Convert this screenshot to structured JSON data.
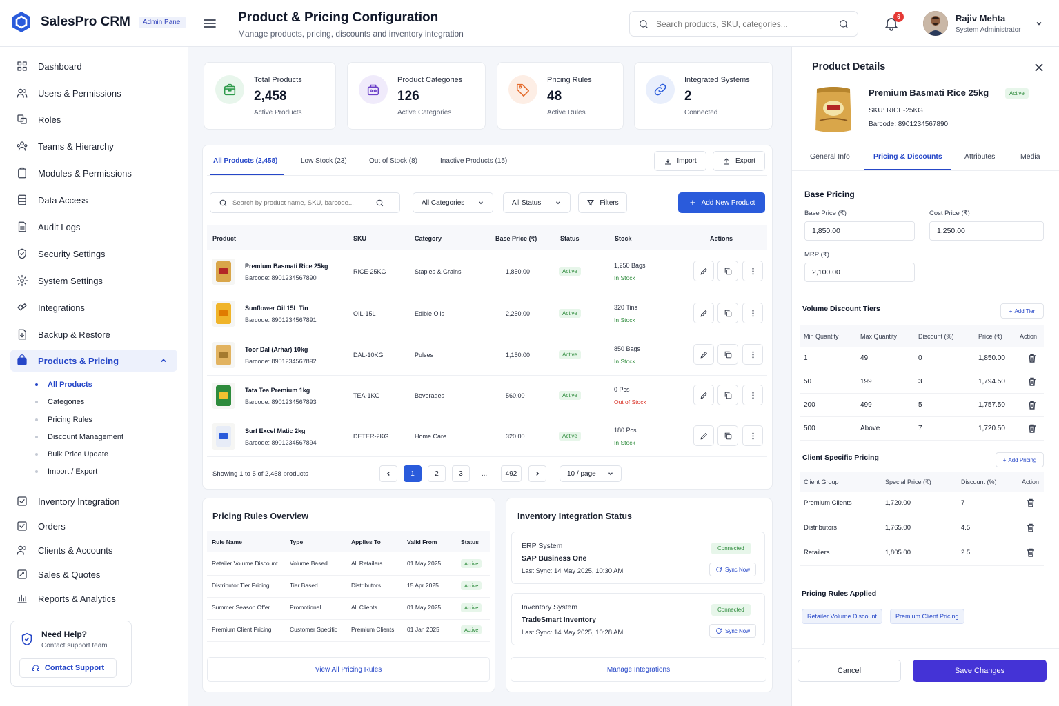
{
  "header": {
    "brand": "SalesPro CRM",
    "brand_tag": "Admin Panel",
    "title": "Product & Pricing Configuration",
    "subtitle": "Manage products, pricing, discounts and inventory integration",
    "search_placeholder": "Search products, SKU, categories...",
    "notifications": "6",
    "user_name": "Rajiv Mehta",
    "user_role": "System Administrator"
  },
  "sidebar": {
    "items": [
      {
        "label": "Dashboard"
      },
      {
        "label": "Users & Permissions"
      },
      {
        "label": "Roles"
      },
      {
        "label": "Teams & Hierarchy"
      },
      {
        "label": "Modules & Permissions"
      },
      {
        "label": "Data Access"
      },
      {
        "label": "Audit Logs"
      },
      {
        "label": "Security Settings"
      },
      {
        "label": "System Settings"
      },
      {
        "label": "Integrations"
      },
      {
        "label": "Backup & Restore"
      },
      {
        "label": "Products & Pricing"
      },
      {
        "label": "Inventory Integration"
      },
      {
        "label": "Orders"
      },
      {
        "label": "Clients & Accounts"
      },
      {
        "label": "Sales & Quotes"
      },
      {
        "label": "Reports & Analytics"
      }
    ],
    "subitems": [
      "All Products",
      "Categories",
      "Pricing Rules",
      "Discount Management",
      "Bulk Price Update",
      "Import / Export"
    ],
    "help_title": "Need Help?",
    "help_sub": "Contact support team",
    "help_button": "Contact Support"
  },
  "stats": [
    {
      "label": "Total Products",
      "value": "2,458",
      "sub": "Active Products",
      "color": "#2e9b4b",
      "bg": "#e8f6ec"
    },
    {
      "label": "Product Categories",
      "value": "126",
      "sub": "Active Categories",
      "color": "#6b3fc8",
      "bg": "#f0ebfb"
    },
    {
      "label": "Pricing Rules",
      "value": "48",
      "sub": "Active Rules",
      "color": "#e46b2c",
      "bg": "#fdeee5"
    },
    {
      "label": "Integrated Systems",
      "value": "2",
      "sub": "Connected",
      "color": "#2a5bdb",
      "bg": "#e9effc"
    }
  ],
  "tabs": [
    "All Products (2,458)",
    "Low Stock (23)",
    "Out of Stock (8)",
    "Inactive Products (15)"
  ],
  "toolbar": {
    "import": "Import",
    "export": "Export",
    "search_placeholder": "Search by product name, SKU, barcode...",
    "categories": "All Categories",
    "status": "All Status",
    "filters": "Filters",
    "add": "Add New Product"
  },
  "table": {
    "headers": [
      "Product",
      "SKU",
      "Category",
      "Base Price (₹)",
      "Status",
      "Stock",
      "Actions"
    ],
    "rows": [
      {
        "name": "Premium Basmati Rice 25kg",
        "barcode": "Barcode: 8901234567890",
        "sku": "RICE-25KG",
        "category": "Staples & Grains",
        "price": "1,850.00",
        "status": "Active",
        "stock": "1,250 Bags",
        "stock_status": "In Stock"
      },
      {
        "name": "Sunflower Oil 15L Tin",
        "barcode": "Barcode: 8901234567891",
        "sku": "OIL-15L",
        "category": "Edible Oils",
        "price": "2,250.00",
        "status": "Active",
        "stock": "320 Tins",
        "stock_status": "In Stock"
      },
      {
        "name": "Toor Dal (Arhar) 10kg",
        "barcode": "Barcode: 8901234567892",
        "sku": "DAL-10KG",
        "category": "Pulses",
        "price": "1,150.00",
        "status": "Active",
        "stock": "850 Bags",
        "stock_status": "In Stock"
      },
      {
        "name": "Tata Tea Premium 1kg",
        "barcode": "Barcode: 8901234567893",
        "sku": "TEA-1KG",
        "category": "Beverages",
        "price": "560.00",
        "status": "Active",
        "stock": "0 Pcs",
        "stock_status": "Out of Stock"
      },
      {
        "name": "Surf Excel Matic 2kg",
        "barcode": "Barcode: 8901234567894",
        "sku": "DETER-2KG",
        "category": "Home Care",
        "price": "320.00",
        "status": "Active",
        "stock": "180 Pcs",
        "stock_status": "In Stock"
      }
    ],
    "showing": "Showing 1 to 5 of 2,458 products",
    "pages": [
      "1",
      "2",
      "3",
      "...",
      "492"
    ],
    "per_page": "10 / page"
  },
  "pricing_rules": {
    "title": "Pricing Rules Overview",
    "headers": [
      "Rule Name",
      "Type",
      "Applies To",
      "Valid From",
      "Status"
    ],
    "rows": [
      [
        "Retailer Volume Discount",
        "Volume Based",
        "All Retailers",
        "01 May 2025",
        "Active"
      ],
      [
        "Distributor Tier Pricing",
        "Tier Based",
        "Distributors",
        "15 Apr 2025",
        "Active"
      ],
      [
        "Summer Season Offer",
        "Promotional",
        "All Clients",
        "01 May 2025",
        "Active"
      ],
      [
        "Premium Client Pricing",
        "Customer Specific",
        "Premium Clients",
        "01 Jan 2025",
        "Active"
      ]
    ],
    "link": "View All Pricing Rules"
  },
  "inventory": {
    "title": "Inventory Integration Status",
    "systems": [
      {
        "type": "ERP System",
        "name": "SAP Business One",
        "sync": "Last Sync: 14 May 2025, 10:30 AM",
        "status": "Connected",
        "action": "Sync Now"
      },
      {
        "type": "Inventory System",
        "name": "TradeSmart Inventory",
        "sync": "Last Sync: 14 May 2025, 10:28 AM",
        "status": "Connected",
        "action": "Sync Now"
      }
    ],
    "link": "Manage Integrations"
  },
  "details": {
    "title": "Product Details",
    "name": "Premium Basmati Rice 25kg",
    "status": "Active",
    "sku": "SKU:  RICE-25KG",
    "barcode": "Barcode:  8901234567890",
    "tabs": [
      "General Info",
      "Pricing & Discounts",
      "Attributes",
      "Media"
    ],
    "base_pricing": "Base Pricing",
    "base_price_label": "Base Price (₹)",
    "base_price": "1,850.00",
    "cost_price_label": "Cost Price (₹)",
    "cost_price": "1,250.00",
    "mrp_label": "MRP (₹)",
    "mrp": "2,100.00",
    "volume_title": "Volume Discount Tiers",
    "add_tier": "Add Tier",
    "volume_headers": [
      "Min Quantity",
      "Max Quantity",
      "Discount (%)",
      "Price (₹)",
      "Action"
    ],
    "volume_rows": [
      [
        "1",
        "49",
        "0",
        "1,850.00"
      ],
      [
        "50",
        "199",
        "3",
        "1,794.50"
      ],
      [
        "200",
        "499",
        "5",
        "1,757.50"
      ],
      [
        "500",
        "Above",
        "7",
        "1,720.50"
      ]
    ],
    "client_title": "Client Specific Pricing",
    "add_pricing": "Add Pricing",
    "client_headers": [
      "Client Group",
      "Special Price (₹)",
      "Discount (%)",
      "Action"
    ],
    "client_rows": [
      [
        "Premium Clients",
        "1,720.00",
        "7"
      ],
      [
        "Distributors",
        "1,765.00",
        "4.5"
      ],
      [
        "Retailers",
        "1,805.00",
        "2.5"
      ]
    ],
    "rules_title": "Pricing Rules Applied",
    "rules": [
      "Retailer Volume Discount",
      "Premium Client Pricing"
    ],
    "cancel": "Cancel",
    "save": "Save Changes"
  }
}
